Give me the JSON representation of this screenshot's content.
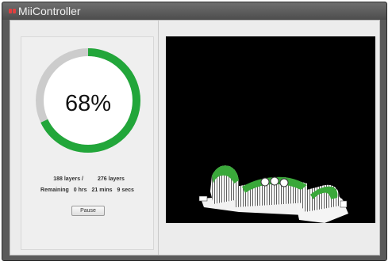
{
  "window": {
    "title": "MiiController"
  },
  "progress": {
    "percent": 0.68,
    "label": "68%",
    "track_color": "#cccccc",
    "fill_color": "#22a63a"
  },
  "status": {
    "layers_done": "188 layers /",
    "layers_total": "276 layers",
    "remaining_label": "Remaining",
    "remaining_hours": "0 hrs",
    "remaining_mins": "21 mins",
    "remaining_secs": "9 secs"
  },
  "controls": {
    "pause_label": "Pause"
  },
  "preview": {
    "background": "#000000",
    "model_color": "#ffffff",
    "highlight_color": "#3aa83a"
  }
}
